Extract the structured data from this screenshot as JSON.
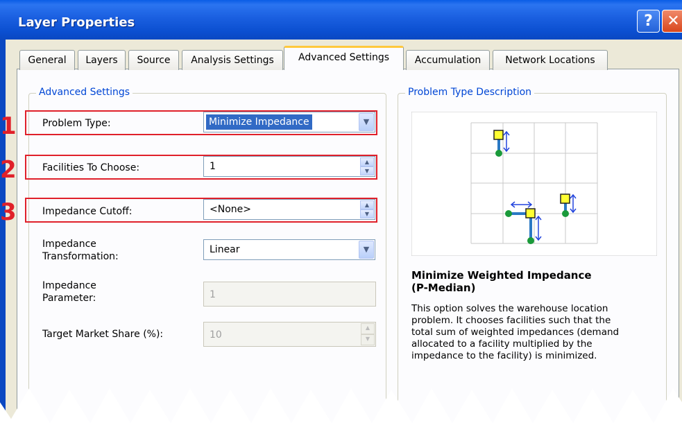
{
  "window": {
    "title": "Layer Properties",
    "help_glyph": "?",
    "close_glyph": "✕"
  },
  "tabs": [
    {
      "label": "General",
      "active": false
    },
    {
      "label": "Layers",
      "active": false
    },
    {
      "label": "Source",
      "active": false
    },
    {
      "label": "Analysis Settings",
      "active": false
    },
    {
      "label": "Advanced Settings",
      "active": true
    },
    {
      "label": "Accumulation",
      "active": false
    },
    {
      "label": "Network Locations",
      "active": false
    }
  ],
  "advanced": {
    "legend": "Advanced Settings",
    "problem_type": {
      "label": "Problem Type:",
      "value": "Minimize Impedance"
    },
    "facilities": {
      "label": "Facilities To Choose:",
      "value": "1"
    },
    "cutoff": {
      "label": "Impedance Cutoff:",
      "value": "<None>"
    },
    "transformation": {
      "label_line1": "Impedance",
      "label_line2": "Transformation:",
      "value": "Linear"
    },
    "parameter": {
      "label_line1": "Impedance",
      "label_line2": "Parameter:",
      "value": "1"
    },
    "market_share": {
      "label": "Target Market Share (%):",
      "value": "10"
    }
  },
  "callouts": [
    "1",
    "2",
    "3"
  ],
  "description": {
    "legend": "Problem Type Description",
    "title_line1": "Minimize Weighted Impedance",
    "title_line2": "(P-Median)",
    "text_lines": [
      "This option solves the warehouse location",
      "problem. It chooses facilities such that the",
      "total sum of weighted impedances (demand",
      "allocated to a facility multiplied by the",
      "impedance to the facility) is minimized."
    ]
  },
  "colors": {
    "title_bar": "#0a48c2",
    "highlight": "#e0202a",
    "legend_text": "#0046d5",
    "selection": "#316ac5"
  }
}
